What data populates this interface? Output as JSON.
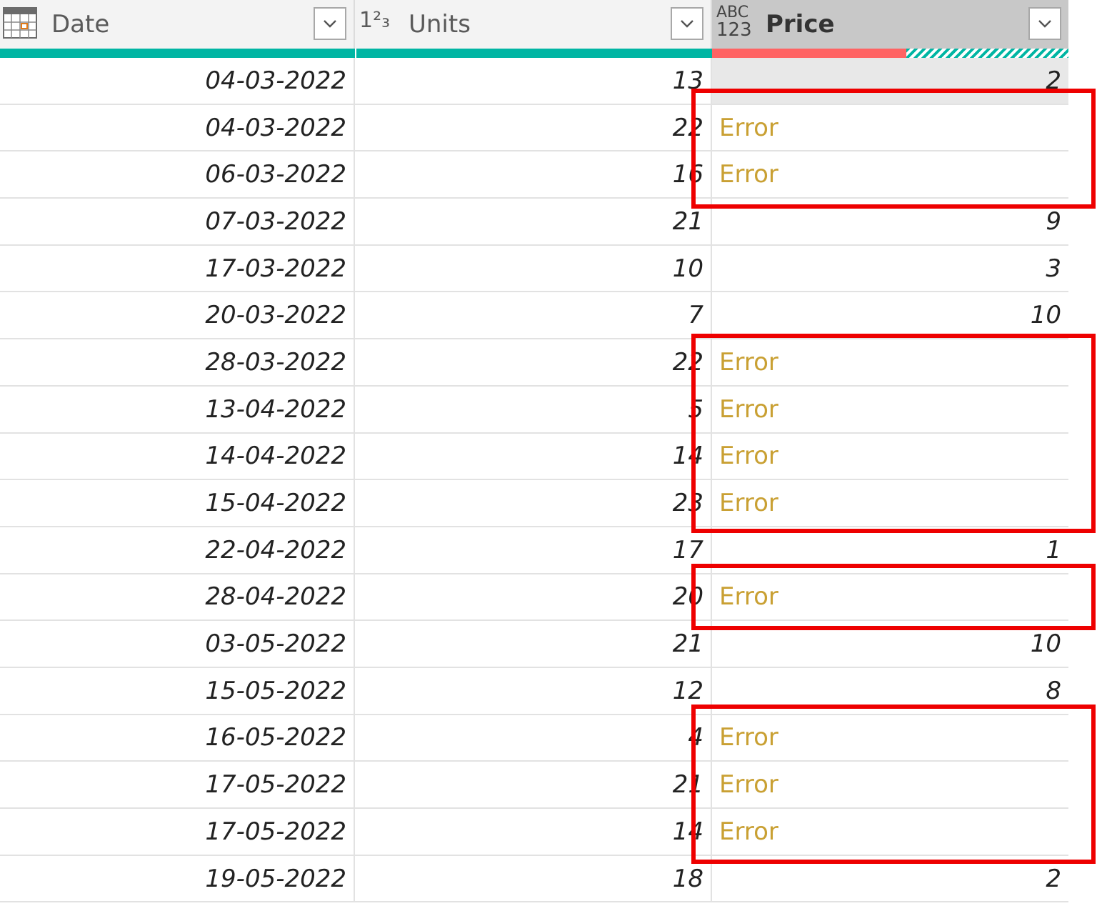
{
  "columns": [
    {
      "name": "Date",
      "type_icon": "calendar-icon"
    },
    {
      "name": "Units",
      "type_icon": "whole-number-icon",
      "type_glyph": "1²₃"
    },
    {
      "name": "Price",
      "type_icon": "any-type-icon",
      "type_glyph_top": "ABC",
      "type_glyph_bottom": "123"
    }
  ],
  "colors": {
    "quality_valid": "#00b5a3",
    "quality_error": "#ff6363",
    "error_text": "#c9a033",
    "highlight_box": "#ee0000"
  },
  "rows": [
    {
      "date": "04-03-2022",
      "units": "13",
      "price": "2"
    },
    {
      "date": "04-03-2022",
      "units": "22",
      "price": "Error"
    },
    {
      "date": "06-03-2022",
      "units": "16",
      "price": "Error"
    },
    {
      "date": "07-03-2022",
      "units": "21",
      "price": "9"
    },
    {
      "date": "17-03-2022",
      "units": "10",
      "price": "3"
    },
    {
      "date": "20-03-2022",
      "units": "7",
      "price": "10"
    },
    {
      "date": "28-03-2022",
      "units": "22",
      "price": "Error"
    },
    {
      "date": "13-04-2022",
      "units": "5",
      "price": "Error"
    },
    {
      "date": "14-04-2022",
      "units": "14",
      "price": "Error"
    },
    {
      "date": "15-04-2022",
      "units": "23",
      "price": "Error"
    },
    {
      "date": "22-04-2022",
      "units": "17",
      "price": "1"
    },
    {
      "date": "28-04-2022",
      "units": "20",
      "price": "Error"
    },
    {
      "date": "03-05-2022",
      "units": "21",
      "price": "10"
    },
    {
      "date": "15-05-2022",
      "units": "12",
      "price": "8"
    },
    {
      "date": "16-05-2022",
      "units": "4",
      "price": "Error"
    },
    {
      "date": "17-05-2022",
      "units": "21",
      "price": "Error"
    },
    {
      "date": "17-05-2022",
      "units": "14",
      "price": "Error"
    },
    {
      "date": "19-05-2022",
      "units": "18",
      "price": "2"
    }
  ]
}
